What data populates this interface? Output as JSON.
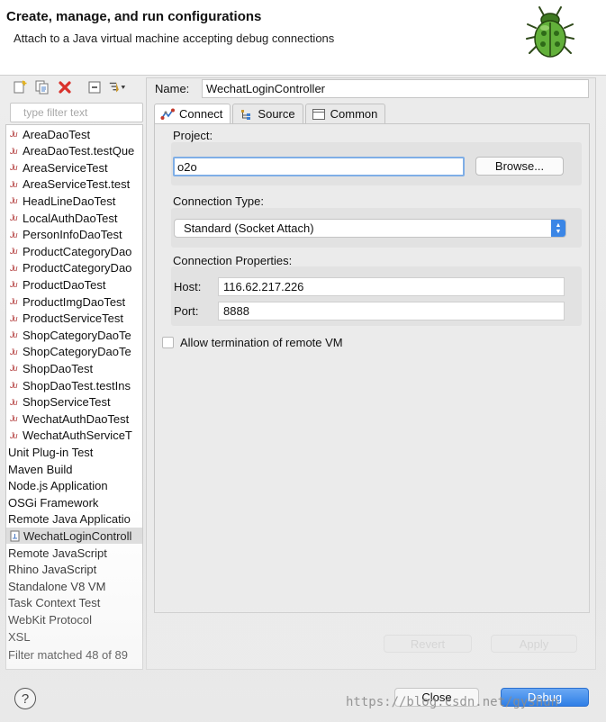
{
  "header": {
    "title": "Create, manage, and run configurations",
    "description": "Attach to a Java virtual machine accepting debug connections",
    "icon": "debug-bug-icon"
  },
  "sidebar": {
    "toolbar_icons": [
      "new-config-icon",
      "duplicate-icon",
      "delete-icon",
      "collapse-all-icon",
      "filter-icon"
    ],
    "filter_placeholder": "type filter text",
    "items": [
      {
        "label": "AreaDaoTest",
        "kind": "junit"
      },
      {
        "label": "AreaDaoTest.testQue",
        "kind": "junit"
      },
      {
        "label": "AreaServiceTest",
        "kind": "junit"
      },
      {
        "label": "AreaServiceTest.test",
        "kind": "junit"
      },
      {
        "label": "HeadLineDaoTest",
        "kind": "junit"
      },
      {
        "label": "LocalAuthDaoTest",
        "kind": "junit"
      },
      {
        "label": "PersonInfoDaoTest",
        "kind": "junit"
      },
      {
        "label": "ProductCategoryDao",
        "kind": "junit"
      },
      {
        "label": "ProductCategoryDao",
        "kind": "junit"
      },
      {
        "label": "ProductDaoTest",
        "kind": "junit"
      },
      {
        "label": "ProductImgDaoTest",
        "kind": "junit"
      },
      {
        "label": "ProductServiceTest",
        "kind": "junit"
      },
      {
        "label": "ShopCategoryDaoTe",
        "kind": "junit"
      },
      {
        "label": "ShopCategoryDaoTe",
        "kind": "junit"
      },
      {
        "label": "ShopDaoTest",
        "kind": "junit"
      },
      {
        "label": "ShopDaoTest.testIns",
        "kind": "junit"
      },
      {
        "label": "ShopServiceTest",
        "kind": "junit"
      },
      {
        "label": "WechatAuthDaoTest",
        "kind": "junit"
      },
      {
        "label": "WechatAuthServiceT",
        "kind": "junit"
      },
      {
        "label": "Unit Plug-in Test",
        "kind": "category"
      },
      {
        "label": "Maven Build",
        "kind": "category"
      },
      {
        "label": "Node.js Application",
        "kind": "category"
      },
      {
        "label": "OSGi Framework",
        "kind": "category"
      },
      {
        "label": "Remote Java Applicatio",
        "kind": "category"
      },
      {
        "label": "WechatLoginControll",
        "kind": "remote",
        "selected": true
      },
      {
        "label": "Remote JavaScript",
        "kind": "category"
      },
      {
        "label": "Rhino JavaScript",
        "kind": "category"
      },
      {
        "label": "Standalone V8 VM",
        "kind": "category"
      },
      {
        "label": "Task Context Test",
        "kind": "category"
      },
      {
        "label": "WebKit Protocol",
        "kind": "category"
      },
      {
        "label": "XSL",
        "kind": "category"
      }
    ],
    "filter_status": "Filter matched 48 of 89"
  },
  "config": {
    "name_label": "Name:",
    "name_value": "WechatLoginController",
    "tabs": [
      {
        "label": "Connect",
        "icon": "connect-icon",
        "active": true
      },
      {
        "label": "Source",
        "icon": "source-icon",
        "active": false
      },
      {
        "label": "Common",
        "icon": "common-icon",
        "active": false
      }
    ],
    "project_label": "Project:",
    "project_value": "o2o",
    "browse_label": "Browse...",
    "connection_type_label": "Connection Type:",
    "connection_type_value": "Standard (Socket Attach)",
    "connection_properties_label": "Connection Properties:",
    "host_label": "Host:",
    "host_value": "116.62.217.226",
    "port_label": "Port:",
    "port_value": "8888",
    "allow_termination_label": "Allow termination of remote VM",
    "allow_termination_checked": false,
    "revert_label": "Revert",
    "apply_label": "Apply"
  },
  "footer": {
    "help_label": "?",
    "close_label": "Close",
    "debug_label": "Debug"
  },
  "watermark": "https://blog.csdn.net/gyshun",
  "colors": {
    "accent": "#3b86e6",
    "focus_border": "#7faee6",
    "delete_red": "#d9312b",
    "junit_red": "#b23b3b"
  }
}
